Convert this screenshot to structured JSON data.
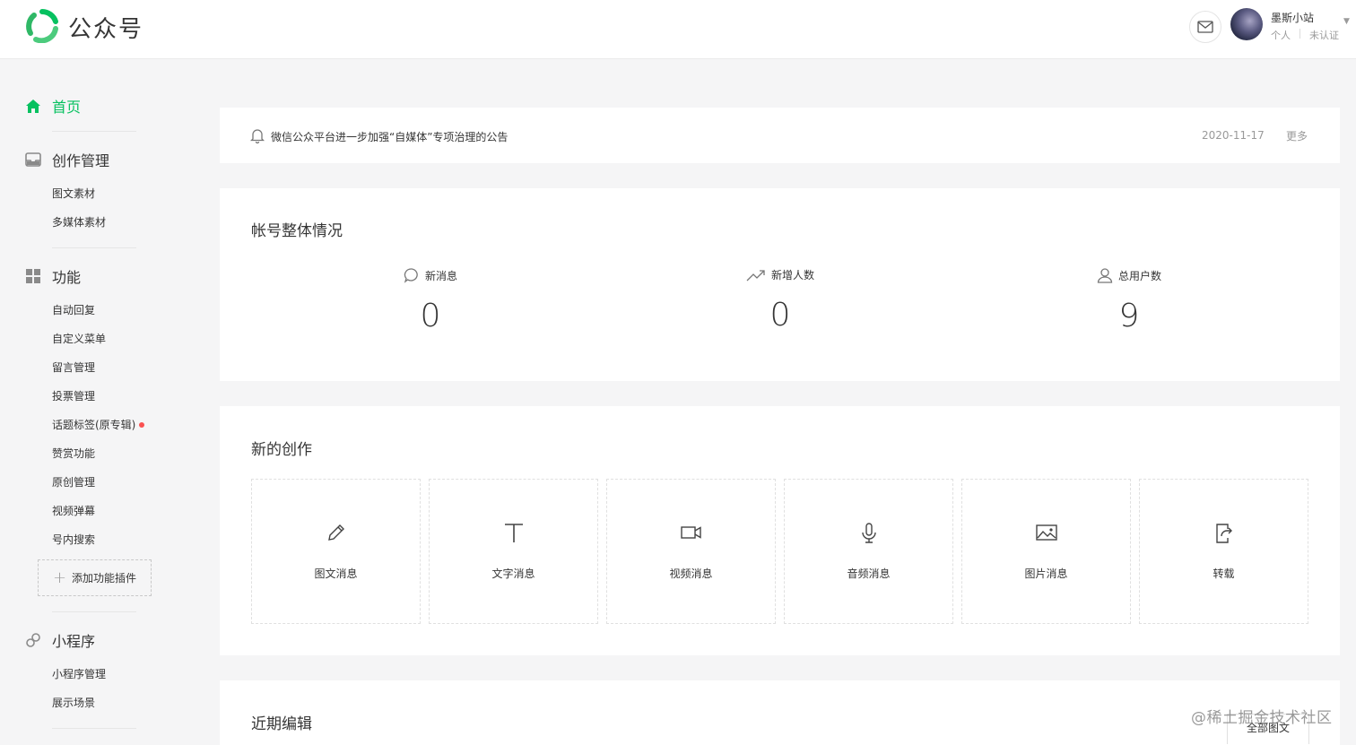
{
  "header": {
    "brand": "公众号",
    "user_name": "墨斯小站",
    "user_type": "个人",
    "user_status": "未认证",
    "accent": "#07c160"
  },
  "sidebar": {
    "home": "首页",
    "creation": {
      "title": "创作管理",
      "items": [
        "图文素材",
        "多媒体素材"
      ]
    },
    "features": {
      "title": "功能",
      "items": [
        "自动回复",
        "自定义菜单",
        "留言管理",
        "投票管理",
        "话题标签(原专辑)",
        "赞赏功能",
        "原创管理",
        "视频弹幕",
        "号内搜索"
      ],
      "add_plugin": "添加功能插件"
    },
    "miniprogram": {
      "title": "小程序",
      "items": [
        "小程序管理",
        "展示场景"
      ]
    }
  },
  "notice": {
    "text": "微信公众平台进一步加强“自媒体”专项治理的公告",
    "date": "2020-11-17",
    "more": "更多"
  },
  "overview": {
    "title": "帐号整体情况",
    "stats": [
      {
        "label": "新消息",
        "value": "0",
        "icon": "message-icon"
      },
      {
        "label": "新增人数",
        "value": "0",
        "icon": "trend-up-icon"
      },
      {
        "label": "总用户数",
        "value": "9",
        "icon": "user-icon"
      }
    ]
  },
  "create": {
    "title": "新的创作",
    "tiles": [
      {
        "label": "图文消息",
        "icon": "pencil-icon"
      },
      {
        "label": "文字消息",
        "icon": "text-icon"
      },
      {
        "label": "视频消息",
        "icon": "video-icon"
      },
      {
        "label": "音频消息",
        "icon": "microphone-icon"
      },
      {
        "label": "图片消息",
        "icon": "image-icon"
      },
      {
        "label": "转载",
        "icon": "repost-icon"
      }
    ]
  },
  "recent": {
    "title": "近期编辑",
    "all_button": "全部图文"
  },
  "watermark": "@稀土掘金技术社区"
}
